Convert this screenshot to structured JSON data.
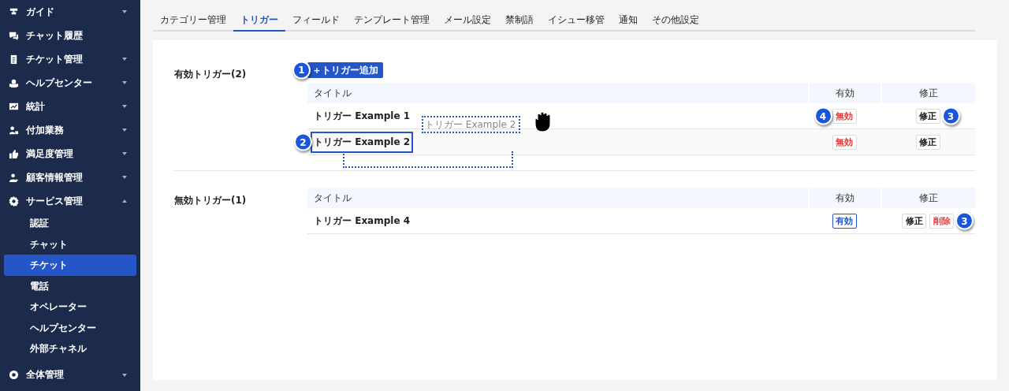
{
  "sidebar": {
    "items": [
      {
        "label": "ガイド",
        "kind": "group",
        "expanded": false
      },
      {
        "label": "チャット履歴",
        "kind": "link"
      },
      {
        "label": "チケット管理",
        "kind": "group",
        "expanded": false
      },
      {
        "label": "ヘルプセンター",
        "kind": "group",
        "expanded": false
      },
      {
        "label": "統計",
        "kind": "group",
        "expanded": false
      },
      {
        "label": "付加業務",
        "kind": "group",
        "expanded": false
      },
      {
        "label": "満足度管理",
        "kind": "group",
        "expanded": false
      },
      {
        "label": "顧客情報管理",
        "kind": "group",
        "expanded": false
      },
      {
        "label": "サービス管理",
        "kind": "group",
        "expanded": true,
        "children": [
          {
            "label": "認証",
            "selected": false
          },
          {
            "label": "チャット",
            "selected": false
          },
          {
            "label": "チケット",
            "selected": true
          },
          {
            "label": "電話",
            "selected": false
          },
          {
            "label": "オペレーター",
            "selected": false
          },
          {
            "label": "ヘルプセンター",
            "selected": false
          },
          {
            "label": "外部チャネル",
            "selected": false
          }
        ]
      },
      {
        "label": "全体管理",
        "kind": "group",
        "expanded": false
      }
    ]
  },
  "tabs": [
    {
      "label": "カテゴリー管理",
      "selected": false
    },
    {
      "label": "トリガー",
      "selected": true
    },
    {
      "label": "フィールド",
      "selected": false
    },
    {
      "label": "テンプレート管理",
      "selected": false
    },
    {
      "label": "メール設定",
      "selected": false
    },
    {
      "label": "禁制語",
      "selected": false
    },
    {
      "label": "イシュー移管",
      "selected": false
    },
    {
      "label": "通知",
      "selected": false
    },
    {
      "label": "その他設定",
      "selected": false
    }
  ],
  "sections": [
    {
      "title": "有効トリガー(2)",
      "add_button": {
        "label": "＋トリガー追加",
        "callout": "1"
      },
      "columns": [
        "タイトル",
        "有効",
        "修正"
      ],
      "drag_preview": {
        "label": "トリガー Example 2"
      },
      "rows": [
        {
          "title": "トリガー Example 1",
          "highlighted": false,
          "toggle": {
            "label": "無効",
            "kind": "disable",
            "callout": "4"
          },
          "actions": [
            {
              "label": "修正",
              "kind": "edit",
              "callout": "3"
            }
          ]
        },
        {
          "title": "トリガー Example 2",
          "highlighted": true,
          "callout": "2",
          "toggle": {
            "label": "無効",
            "kind": "disable"
          },
          "actions": [
            {
              "label": "修正",
              "kind": "edit"
            }
          ]
        }
      ]
    },
    {
      "title": "無効トリガー(1)",
      "columns": [
        "タイトル",
        "有効",
        "修正"
      ],
      "rows": [
        {
          "title": "トリガー Example 4",
          "highlighted": false,
          "toggle": {
            "label": "有効",
            "kind": "enable"
          },
          "actions": [
            {
              "label": "修正",
              "kind": "edit"
            },
            {
              "label": "削除",
              "kind": "delete",
              "callout": "3"
            }
          ]
        }
      ]
    }
  ]
}
